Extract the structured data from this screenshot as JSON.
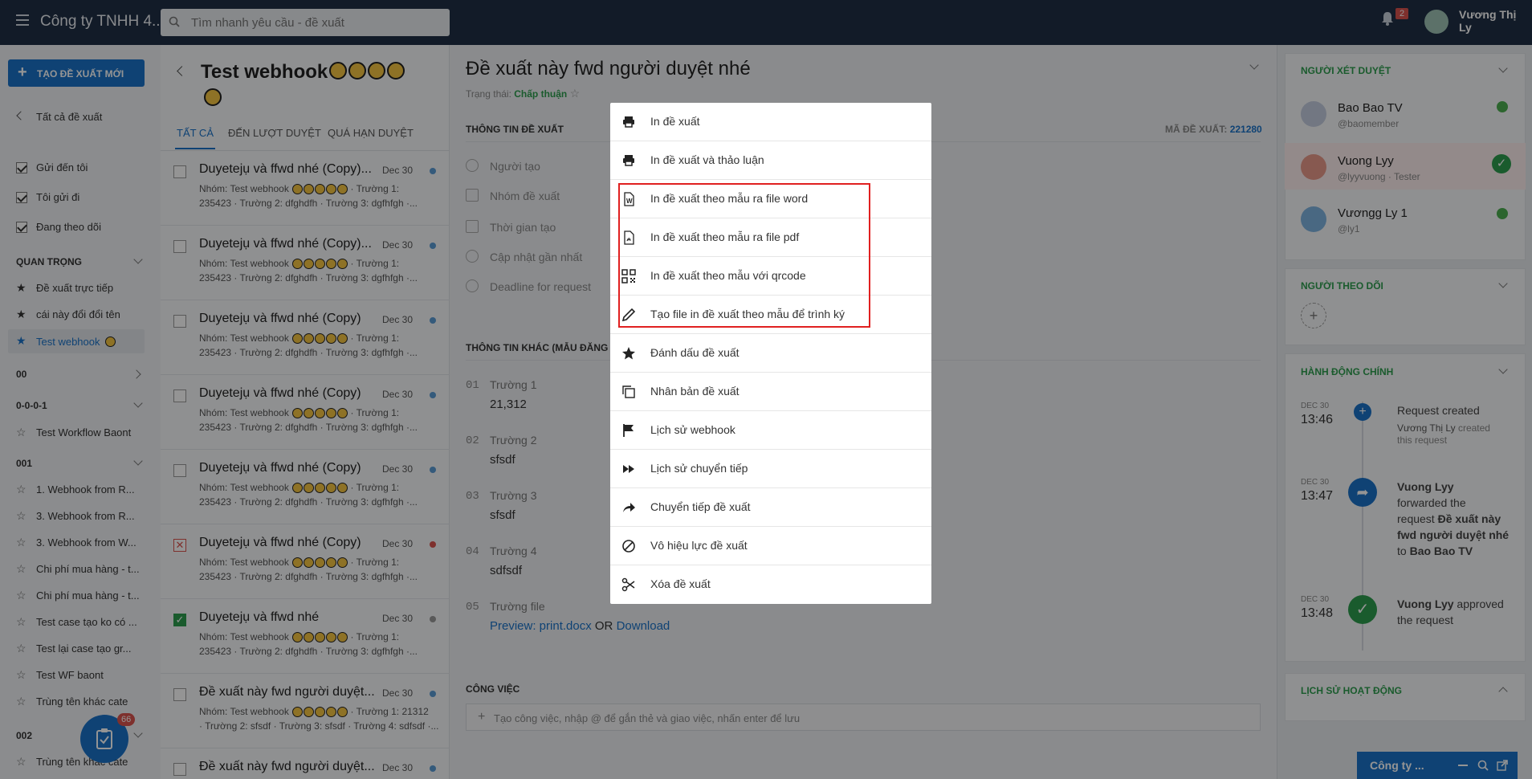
{
  "topbar": {
    "company": "Công ty TNHH 4...",
    "search_placeholder": "Tìm nhanh yêu cầu - đề xuất",
    "notif_count": "2",
    "user_name": "Vương Thị Ly"
  },
  "sidebar": {
    "create_label": "TẠO ĐỀ XUẤT MỚI",
    "all_label": "Tất cả đề xuất",
    "filters": [
      "Gửi đến tôi",
      "Tôi gửi đi",
      "Đang theo dõi"
    ],
    "sections": {
      "important": "QUAN TRỌNG",
      "s00": "00",
      "s0001": "0-0-0-1",
      "s001": "001",
      "s002": "002"
    },
    "important_items": [
      "Đề xuất trực tiếp",
      "cái này đổi đổi tên",
      "Test webhook"
    ],
    "s0001_items": [
      "Test Workflow Baont"
    ],
    "s001_items": [
      "1. Webhook from R...",
      "3. Webhook from R...",
      "3. Webhook from W...",
      "Chi phí mua hàng - t...",
      "Chi phí mua hàng - t...",
      "Test case tạo ko có ...",
      "Test lại case tạo gr...",
      "Test WF baont",
      "Trùng tên khác cate"
    ],
    "s002_items": [
      "Trùng tên khác cate"
    ],
    "fab_badge": "66"
  },
  "list": {
    "title": "Test webhook",
    "tabs": [
      "TẤT CẢ",
      "ĐẾN LƯỢT DUYỆT",
      "QUÁ HẠN DUYỆT"
    ],
    "items": [
      {
        "title": "Duyetejụ và ffwd nhé (Copy)...",
        "date": "Dec 30",
        "s1": "Nhóm: Test webhook",
        "s1b": "· Trường 1:",
        "s2": "235423 · Trường 2: dfghdfh · Trường 3: dgfhfgh ·..."
      },
      {
        "title": "Duyetejụ và ffwd nhé (Copy)...",
        "date": "Dec 30",
        "s1": "Nhóm: Test webhook",
        "s1b": "· Trường 1:",
        "s2": "235423 · Trường 2: dfghdfh · Trường 3: dgfhfgh ·..."
      },
      {
        "title": "Duyetejụ và ffwd nhé (Copy)",
        "date": "Dec 30",
        "s1": "Nhóm: Test webhook",
        "s1b": "· Trường 1:",
        "s2": "235423 · Trường 2: dfghdfh · Trường 3: dgfhfgh ·..."
      },
      {
        "title": "Duyetejụ và ffwd nhé (Copy)",
        "date": "Dec 30",
        "s1": "Nhóm: Test webhook",
        "s1b": "· Trường 1:",
        "s2": "235423 · Trường 2: dfghdfh · Trường 3: dgfhfgh ·..."
      },
      {
        "title": "Duyetejụ và ffwd nhé (Copy)",
        "date": "Dec 30",
        "s1": "Nhóm: Test webhook",
        "s1b": "· Trường 1:",
        "s2": "235423 · Trường 2: dfghdfh · Trường 3: dgfhfgh ·..."
      },
      {
        "title": "Duyetejụ và ffwd nhé (Copy)",
        "date": "Dec 30",
        "s1": "Nhóm: Test webhook",
        "s1b": "· Trường 1:",
        "s2": "235423 · Trường 2: dfghdfh · Trường 3: dgfhfgh ·..."
      },
      {
        "title": "Duyetejụ và ffwd nhé",
        "date": "Dec 30",
        "s1": "Nhóm: Test webhook",
        "s1b": "· Trường 1:",
        "s2": "235423 · Trường 2: dfghdfh · Trường 3: dgfhfgh ·..."
      },
      {
        "title": "Đề xuất này fwd người duyệt...",
        "date": "Dec 30",
        "s1": "Nhóm: Test webhook",
        "s1b": "· Trường 1: 21312",
        "s2": "· Trường 2: sfsdf · Trường 3: sfsdf · Trường 4: sdfsdf ·..."
      },
      {
        "title": "Đề xuất này fwd người duyệt...",
        "date": "Dec 30",
        "s1": "",
        "s1b": "",
        "s2": ""
      }
    ]
  },
  "detail": {
    "title": "Đề xuất này fwd người duyệt nhé",
    "status_label": "Trạng thái:",
    "status_value": "Chấp thuận",
    "section_info": "THÔNG TIN ĐỀ XUẤT",
    "code_label": "MÃ ĐỀ XUẤT:",
    "code_value": "221280",
    "info_labels": [
      "Người tạo",
      "Nhóm đề xuất",
      "Thời gian tạo",
      "Cập nhật gần nhất",
      "Deadline for request"
    ],
    "section_other": "THÔNG TIN KHÁC (MẪU ĐĂNG KÝ",
    "fields": [
      {
        "num": "01",
        "label": "Trường 1",
        "value": "21,312"
      },
      {
        "num": "02",
        "label": "Trường 2",
        "value": "sfsdf"
      },
      {
        "num": "03",
        "label": "Trường 3",
        "value": "sfsdf"
      },
      {
        "num": "04",
        "label": "Trường 4",
        "value": "sdfsdf"
      }
    ],
    "file_num": "05",
    "file_label": "Trường file",
    "preview_link": "Preview: print.docx",
    "or_text": "OR",
    "download_link": "Download",
    "section_task": "CÔNG VIỆC",
    "task_placeholder": "Tạo công việc, nhập @ để gắn thẻ và giao việc, nhấn enter để lưu"
  },
  "right": {
    "approvers_title": "NGƯỜI XÉT DUYỆT",
    "approvers": [
      {
        "name": "Bao Bao TV",
        "sub": "@baomember"
      },
      {
        "name": "Vuong Lyy",
        "sub": "@lyyvuong · Tester"
      },
      {
        "name": "Vươngg Ly 1",
        "sub": "@ly1"
      }
    ],
    "followers_title": "NGƯỜI THEO DÕI",
    "actions_title": "HÀNH ĐỘNG CHÍNH",
    "timeline": [
      {
        "date": "DEC 30",
        "time": "13:46",
        "line1": "Request created",
        "line2": "Vương Thị Ly",
        "line3": "created",
        "line4": "this request"
      },
      {
        "date": "DEC 30",
        "time": "13:47",
        "actor": "Vuong Lyy",
        "t1": "forwarded the",
        "t2": "request",
        "bold1": "Đề xuất này",
        "bold2": "fwd người duyệt nhé",
        "to": "to",
        "target": "Bao Bao TV"
      },
      {
        "date": "DEC 30",
        "time": "13:48",
        "actor": "Vuong Lyy",
        "t1": "approved",
        "t2": "the request"
      }
    ],
    "history_title": "LỊCH SỬ HOẠT ĐỘNG",
    "chat_label": "Công ty ..."
  },
  "menu": {
    "items": [
      {
        "label": "In đề xuất",
        "icon": "printer-icon"
      },
      {
        "label": "In đề xuất và thảo luận",
        "icon": "printer-icon"
      },
      {
        "label": "In đề xuất theo mẫu ra file word",
        "icon": "word-file-icon"
      },
      {
        "label": "In đề xuất theo mẫu ra file pdf",
        "icon": "pdf-file-icon"
      },
      {
        "label": "In đề xuất theo mẫu với qrcode",
        "icon": "qrcode-icon"
      },
      {
        "label": "Tạo file in đề xuất theo mẫu để trình ký",
        "icon": "pencil-icon"
      },
      {
        "label": "Đánh dấu đề xuất",
        "icon": "star-icon"
      },
      {
        "label": "Nhân bản đề xuất",
        "icon": "copy-icon"
      },
      {
        "label": "Lịch sử webhook",
        "icon": "flag-icon"
      },
      {
        "label": "Lịch sử chuyển tiếp",
        "icon": "fast-forward-icon"
      },
      {
        "label": "Chuyển tiếp đề xuất",
        "icon": "share-arrow-icon"
      },
      {
        "label": "Vô hiệu lực đề xuất",
        "icon": "ban-icon"
      },
      {
        "label": "Xóa đề xuất",
        "icon": "scissors-icon"
      }
    ]
  }
}
